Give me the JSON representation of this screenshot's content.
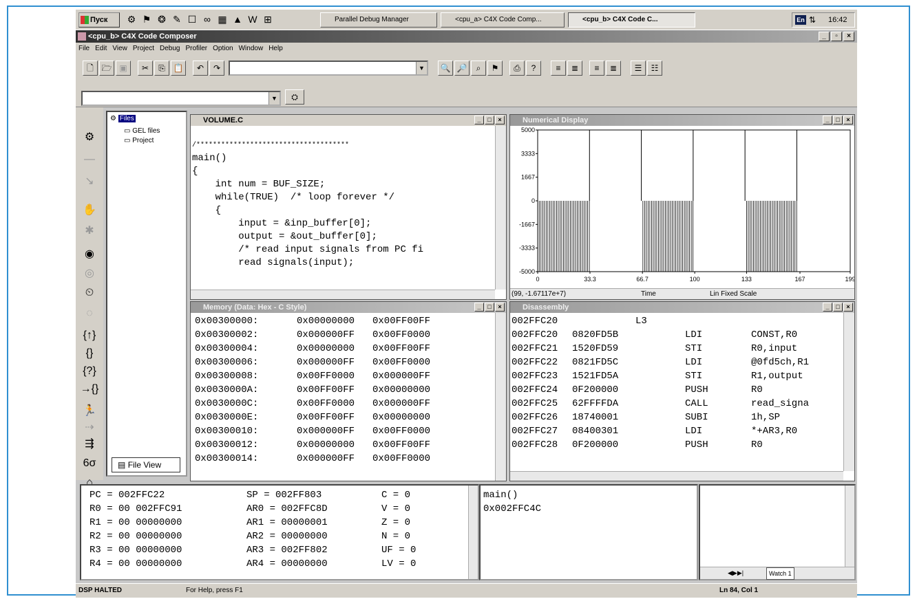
{
  "taskbar": {
    "start_label": "Пуск",
    "tasks": [
      "Parallel Debug Manager",
      "<cpu_a> C4X Code Comp...",
      "<cpu_b> C4X Code C..."
    ],
    "tray_lang": "En",
    "clock": "16:42"
  },
  "window": {
    "title": "<cpu_b> C4X Code Composer"
  },
  "menu": [
    "File",
    "Edit",
    "View",
    "Project",
    "Debug",
    "Profiler",
    "Option",
    "Window",
    "Help"
  ],
  "fileview": {
    "root": "Files",
    "items": [
      "GEL files",
      "Project"
    ],
    "tab_label": "File View"
  },
  "source_window": {
    "title": "VOLUME.C",
    "lines": [
      "/*************************************",
      "main()",
      "{",
      "    int num = BUF_SIZE;",
      "    while(TRUE)  /* loop forever */",
      "    {",
      "        input = &inp_buffer[0];",
      "        output = &out_buffer[0];",
      "        /* read input signals from PC fi",
      "        read signals(input);"
    ]
  },
  "graph_window": {
    "title": "Numerical Display",
    "status_coord": "(99, -1.67117e+7)",
    "status_time": "Time",
    "status_scale": "Lin   Fixed Scale"
  },
  "chart_data": {
    "type": "line",
    "title": "",
    "xlabel": "Time",
    "ylabel": "",
    "x_ticks": [
      "0",
      "33.3",
      "66.7",
      "100",
      "133",
      "167",
      "199"
    ],
    "y_ticks": [
      "5000",
      "3333",
      "1667",
      "0",
      "-1667",
      "-3333",
      "-5000"
    ],
    "xlim": [
      0,
      199
    ],
    "ylim": [
      -5000,
      5000
    ],
    "pulse_edges": [
      33,
      66,
      99,
      132,
      165
    ],
    "pulse_level": 5000,
    "burst_ranges": [
      [
        0,
        33
      ],
      [
        66,
        99
      ],
      [
        132,
        165
      ]
    ],
    "burst_amplitude": [
      -5000,
      0
    ]
  },
  "memory_window": {
    "title": "Memory (Data: Hex - C Style)",
    "rows": [
      [
        "0x00300000:",
        "0x00000000",
        "0x00FF00FF"
      ],
      [
        "0x00300002:",
        "0x000000FF",
        "0x00FF0000"
      ],
      [
        "0x00300004:",
        "0x00000000",
        "0x00FF00FF"
      ],
      [
        "0x00300006:",
        "0x000000FF",
        "0x00FF0000"
      ],
      [
        "0x00300008:",
        "0x00FF0000",
        "0x000000FF"
      ],
      [
        "0x0030000A:",
        "0x00FF00FF",
        "0x00000000"
      ],
      [
        "0x0030000C:",
        "0x00FF0000",
        "0x000000FF"
      ],
      [
        "0x0030000E:",
        "0x00FF00FF",
        "0x00000000"
      ],
      [
        "0x00300010:",
        "0x000000FF",
        "0x00FF0000"
      ],
      [
        "0x00300012:",
        "0x00000000",
        "0x00FF00FF"
      ],
      [
        "0x00300014:",
        "0x000000FF",
        "0x00FF0000"
      ]
    ]
  },
  "disasm_window": {
    "title": "Disassembly",
    "rows": [
      [
        "002FFC20",
        "",
        "L3",
        ""
      ],
      [
        "002FFC20",
        "0820FD5B",
        "LDI",
        "CONST,R0"
      ],
      [
        "002FFC21",
        "1520FD59",
        "STI",
        "R0,input"
      ],
      [
        "002FFC22",
        "0821FD5C",
        "LDI",
        "@0fd5ch,R1"
      ],
      [
        "002FFC23",
        "1521FD5A",
        "STI",
        "R1,output"
      ],
      [
        "002FFC24",
        "0F200000",
        "PUSH",
        "R0"
      ],
      [
        "002FFC25",
        "62FFFFDA",
        "CALL",
        "read_signa"
      ],
      [
        "002FFC26",
        "18740001",
        "SUBI",
        "1h,SP"
      ],
      [
        "002FFC27",
        "08400301",
        "LDI",
        "*+AR3,R0"
      ],
      [
        "002FFC28",
        "0F200000",
        "PUSH",
        "R0"
      ]
    ]
  },
  "registers": {
    "col1": [
      "PC = 002FFC22",
      "R0 = 00 002FFC91",
      "R1 = 00 00000000",
      "R2 = 00 00000000",
      "R3 = 00 00000000",
      "R4 = 00 00000000"
    ],
    "col2": [
      "SP = 002FF803",
      "AR0 = 002FFC8D",
      "AR1 = 00000001",
      "AR2 = 00000000",
      "AR3 = 002FF802",
      "AR4 = 00000000"
    ],
    "col3": [
      "C = 0",
      "V = 0",
      "Z = 0",
      "N = 0",
      "UF = 0",
      "LV = 0"
    ]
  },
  "call_stack": [
    "main()",
    "0x002FFC4C"
  ],
  "watch": {
    "tab_label": "Watch 1"
  },
  "status": {
    "state": "DSP HALTED",
    "help": "For Help, press F1",
    "position": "Ln 84, Col 1"
  }
}
